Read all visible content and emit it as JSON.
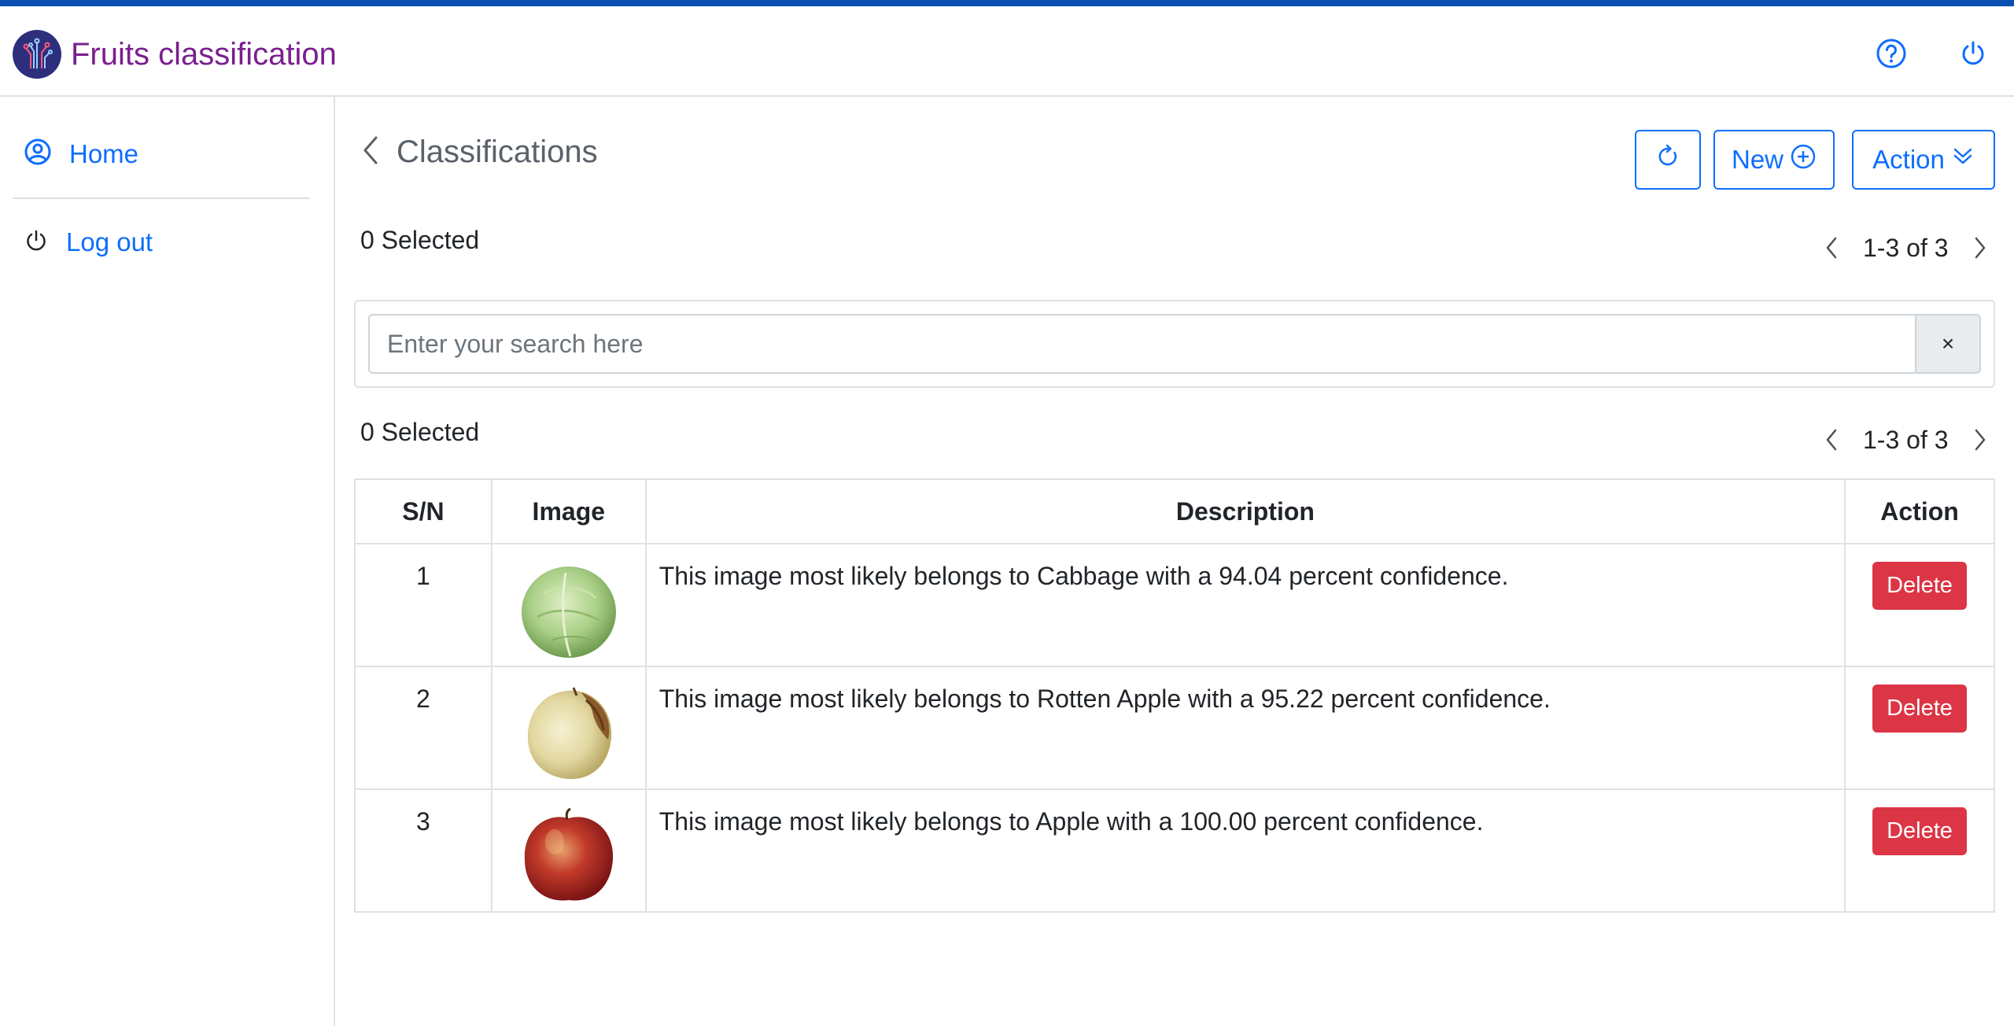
{
  "app": {
    "title": "Fruits classification",
    "accent_color": "#0b4fb3",
    "title_color": "#7a1f8f",
    "primary_color": "#0d6efd",
    "danger_color": "#dc3545"
  },
  "header": {
    "icons": [
      "help-circle-icon",
      "power-icon"
    ]
  },
  "sidebar": {
    "items": [
      {
        "label": "Home",
        "icon": "user-circle-icon"
      },
      {
        "label": "Log out",
        "icon": "power-icon"
      }
    ]
  },
  "page": {
    "title": "Classifications",
    "buttons": {
      "refresh_icon": "refresh-icon",
      "new_label": "New",
      "action_label": "Action"
    },
    "selected_top": "0 Selected",
    "selected_bottom": "0 Selected",
    "pagination_top": "1-3 of 3",
    "pagination_bottom": "1-3 of 3",
    "search": {
      "placeholder": "Enter your search here",
      "value": "",
      "clear_label": "×"
    }
  },
  "table": {
    "headers": [
      "S/N",
      "Image",
      "Description",
      "Action"
    ],
    "rows": [
      {
        "sn": "1",
        "image": "cabbage",
        "description": "This image most likely belongs to Cabbage with a 94.04 percent confidence.",
        "action": "Delete"
      },
      {
        "sn": "2",
        "image": "rotten-apple",
        "description": "This image most likely belongs to Rotten Apple with a 95.22 percent confidence.",
        "action": "Delete"
      },
      {
        "sn": "3",
        "image": "apple",
        "description": "This image most likely belongs to Apple with a 100.00 percent confidence.",
        "action": "Delete"
      }
    ]
  }
}
